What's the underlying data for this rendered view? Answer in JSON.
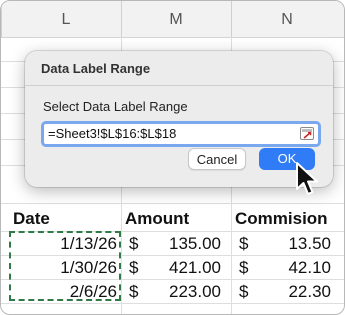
{
  "spreadsheet": {
    "columns": [
      "L",
      "M",
      "N"
    ],
    "headers": [
      "Date",
      "Amount",
      "Commision"
    ],
    "rows": [
      {
        "date": "1/13/26",
        "amount_symbol": "$",
        "amount": "135.00",
        "commission_symbol": "$",
        "commission": "13.50"
      },
      {
        "date": "1/30/26",
        "amount_symbol": "$",
        "amount": "421.00",
        "commission_symbol": "$",
        "commission": "42.10"
      },
      {
        "date": "2/6/26",
        "amount_symbol": "$",
        "amount": "223.00",
        "commission_symbol": "$",
        "commission": "22.30"
      }
    ]
  },
  "dialog": {
    "title": "Data Label Range",
    "prompt": "Select Data Label Range",
    "range_value": "=Sheet3!$L$16:$L$18",
    "cancel_label": "Cancel",
    "ok_label": "OK",
    "accent_color": "#2f7cf6"
  },
  "icons": {
    "range_picker": "range-select-icon",
    "pointer": "mouse-pointer-icon"
  }
}
